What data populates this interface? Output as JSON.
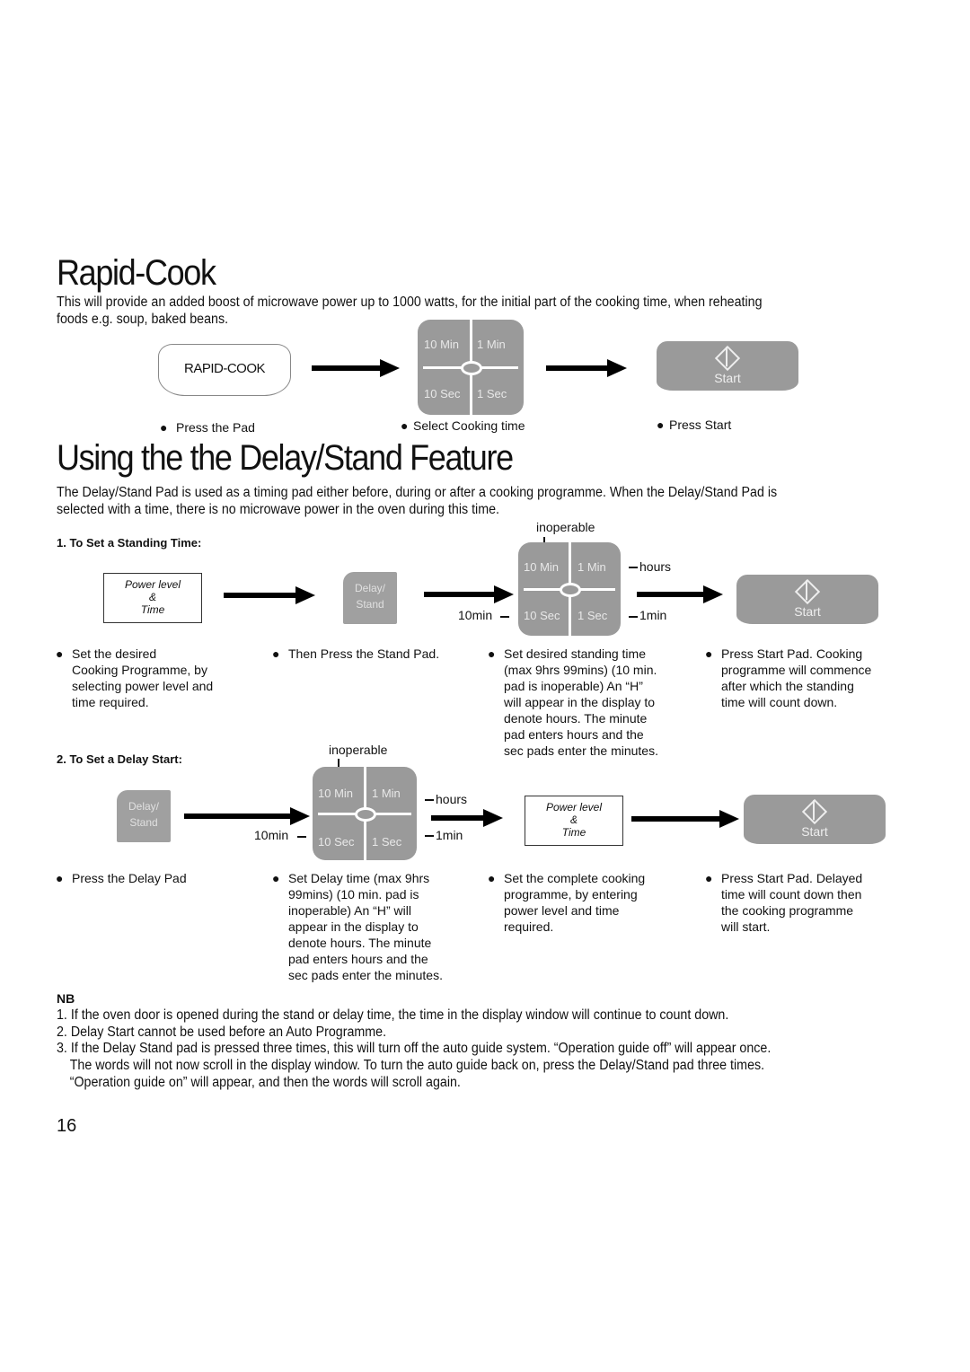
{
  "page_number": "16",
  "rapid_cook": {
    "title": "Rapid-Cook",
    "intro_line1": "This will provide an added boost of microwave power up to 1000 watts, for the initial part of the cooking time, when reheating",
    "intro_line2": "foods e.g. soup, baked beans.",
    "pad_label": "RAPID-COOK",
    "steps": [
      "Press the Pad",
      "Select Cooking time",
      "Press Start"
    ]
  },
  "time_pad": {
    "keys": [
      "10 Min",
      "1 Min",
      "10 Sec",
      "1 Sec"
    ]
  },
  "start_pad": {
    "label": "Start"
  },
  "delay_pad": {
    "line1": "Delay/",
    "line2": "Stand"
  },
  "power_box": {
    "line1": "Power level",
    "line2": "&",
    "line3": "Time"
  },
  "annotations": {
    "inoperable": "inoperable",
    "hours": "hours",
    "ten_min": "10min",
    "one_min": "1min"
  },
  "delay_stand": {
    "title": "Using the the Delay/Stand Feature",
    "intro_line1": "The Delay/Stand Pad is used as a timing pad either before, during or after a cooking programme. When the Delay/Stand Pad is",
    "intro_line2": "selected with a time, there is no microwave power in the oven during this time.",
    "standing": {
      "heading": "1.  To Set a Standing Time:",
      "steps": [
        [
          "Set the desired",
          "Cooking Programme, by",
          "selecting power level and",
          "time required."
        ],
        [
          "Then Press the Stand Pad."
        ],
        [
          "Set desired standing time",
          "(max 9hrs 99mins) (10 min.",
          "pad is inoperable) An “H”",
          "will appear in the display to",
          "denote hours. The minute",
          "pad enters hours and the",
          "sec pads enter the minutes."
        ],
        [
          "Press Start Pad. Cooking",
          "programme will commence",
          "after which the standing",
          "time will count down."
        ]
      ]
    },
    "delay_start": {
      "heading": "2.  To Set a Delay Start:",
      "steps": [
        [
          "Press the Delay Pad"
        ],
        [
          "Set Delay time (max 9hrs",
          "99mins) (10 min. pad is",
          "inoperable) An “H” will",
          "appear in the display to",
          "denote hours. The minute",
          "pad enters hours and the",
          "sec pads enter the minutes."
        ],
        [
          "Set the complete cooking",
          "programme, by entering",
          "power level and time",
          "required."
        ],
        [
          "Press Start Pad. Delayed",
          "time will count down then",
          "the cooking programme",
          "will start."
        ]
      ]
    }
  },
  "nb": {
    "heading": "NB",
    "items": [
      {
        "num": "1.",
        "lines": [
          "If the oven door is opened during the stand or delay time, the time in the display window will continue to count down."
        ]
      },
      {
        "num": "2.",
        "lines": [
          "Delay Start cannot be used before an Auto Programme."
        ]
      },
      {
        "num": "3.",
        "lines": [
          "If the Delay Stand pad is pressed three times, this will turn off the auto guide system. “Operation guide off” will appear once.",
          "The words will not now scroll in the display window. To turn the auto guide back on, press the Delay/Stand pad three times.",
          "“Operation guide on” will appear, and then the words will scroll again."
        ]
      }
    ]
  }
}
